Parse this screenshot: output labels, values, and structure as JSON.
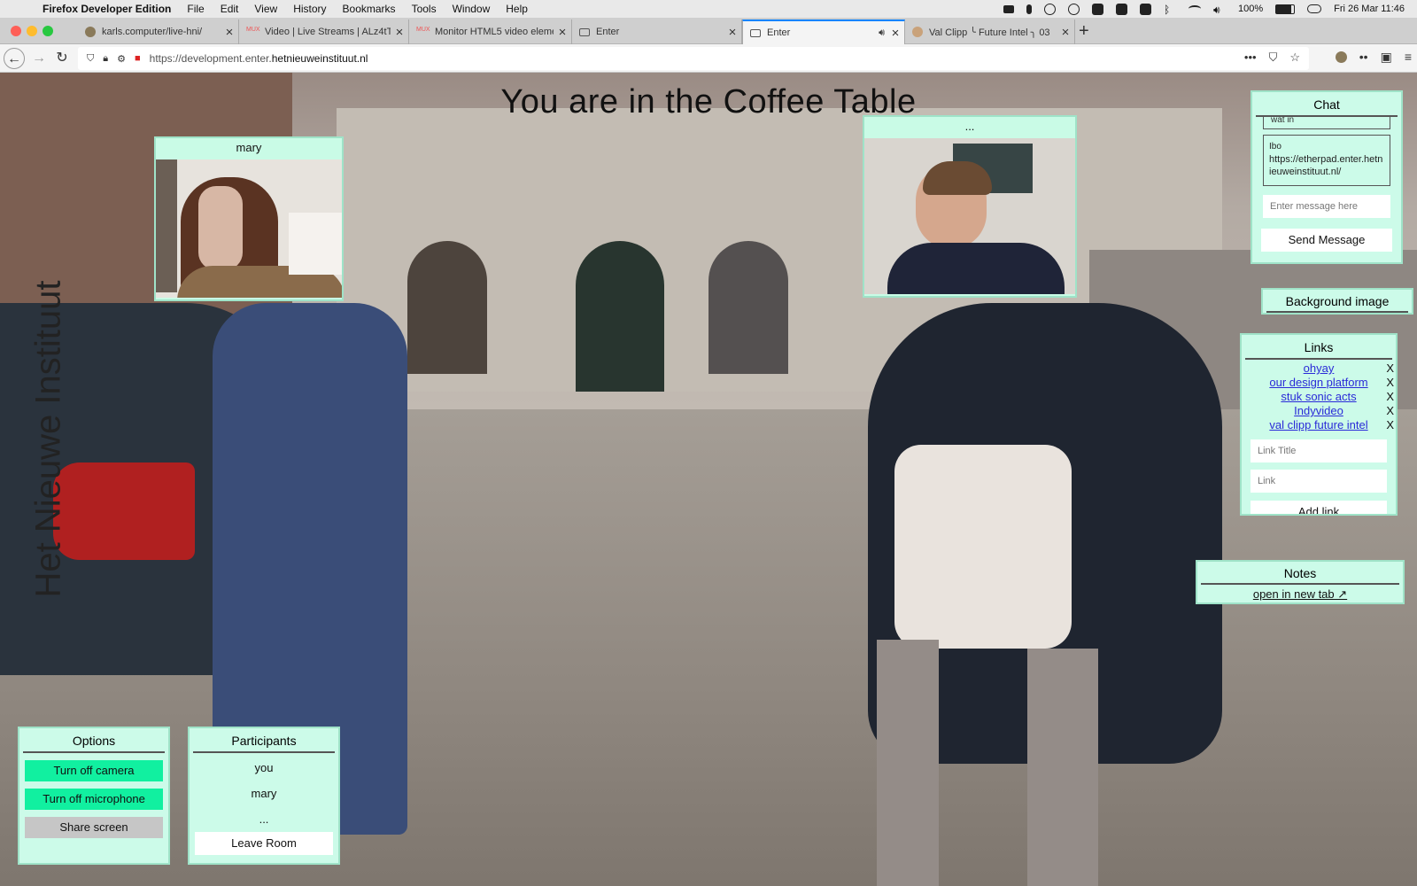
{
  "menubar": {
    "app": "Firefox Developer Edition",
    "items": [
      "File",
      "Edit",
      "View",
      "History",
      "Bookmarks",
      "Tools",
      "Window",
      "Help"
    ],
    "battery": "100%",
    "clock": "Fri 26 Mar  11:46"
  },
  "tabs": [
    {
      "title": "karls.computer/live-hni/"
    },
    {
      "title": "Video | Live Streams | ALz4tTD"
    },
    {
      "title": "Monitor HTML5 video element"
    },
    {
      "title": "Enter"
    },
    {
      "title": "Enter"
    },
    {
      "title": "Val Clipp ╰ Future Intel ╮ 03"
    }
  ],
  "url": {
    "prefix": "https://development.enter.",
    "domain": "hetnieuweinstituut.nl"
  },
  "page": {
    "title": "You are in the Coffee Table",
    "brand": "Het Nieuwe Instituut"
  },
  "videos": [
    {
      "name": "mary"
    },
    {
      "name": "..."
    }
  ],
  "chat": {
    "title": "Chat",
    "partial_message": "wat in",
    "message_author": "Ibo",
    "message_text": "https://etherpad.enter.hetnieuweinstituut.nl/",
    "input_placeholder": "Enter message here",
    "send_label": "Send Message"
  },
  "background_button": "Background image",
  "links": {
    "title": "Links",
    "items": [
      {
        "label": "ohyay"
      },
      {
        "label": "our design platform"
      },
      {
        "label": "stuk sonic acts"
      },
      {
        "label": "Indyvideo"
      },
      {
        "label": "val clipp future intel"
      }
    ],
    "remove_label": "X",
    "title_placeholder": "Link Title",
    "link_placeholder": "Link",
    "add_label": "Add link"
  },
  "notes": {
    "title": "Notes",
    "open_label": "open in new tab ↗"
  },
  "options": {
    "title": "Options",
    "camera": "Turn off camera",
    "microphone": "Turn off microphone",
    "share": "Share screen"
  },
  "participants": {
    "title": "Participants",
    "list": [
      "you",
      "mary",
      "..."
    ],
    "leave": "Leave Room"
  }
}
